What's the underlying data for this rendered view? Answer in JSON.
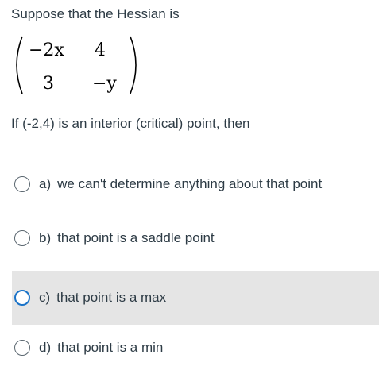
{
  "question": {
    "intro": "Suppose that the Hessian is",
    "matrix": {
      "a": "−2x",
      "b": "4",
      "c": "3",
      "d": "−y"
    },
    "prompt": "If (-2,4) is an interior (critical) point, then"
  },
  "answers": [
    {
      "letter": "a)",
      "text": "we can't determine anything about that point",
      "selected": false
    },
    {
      "letter": "b)",
      "text": "that point is a saddle point",
      "selected": false
    },
    {
      "letter": "c)",
      "text": "that point is a max",
      "selected": true
    },
    {
      "letter": "d)",
      "text": "that point is a min",
      "selected": false
    }
  ],
  "colors": {
    "text": "#2d3b45",
    "selected_background": "#e5e5e5",
    "selected_radio": "#1a73c8"
  }
}
